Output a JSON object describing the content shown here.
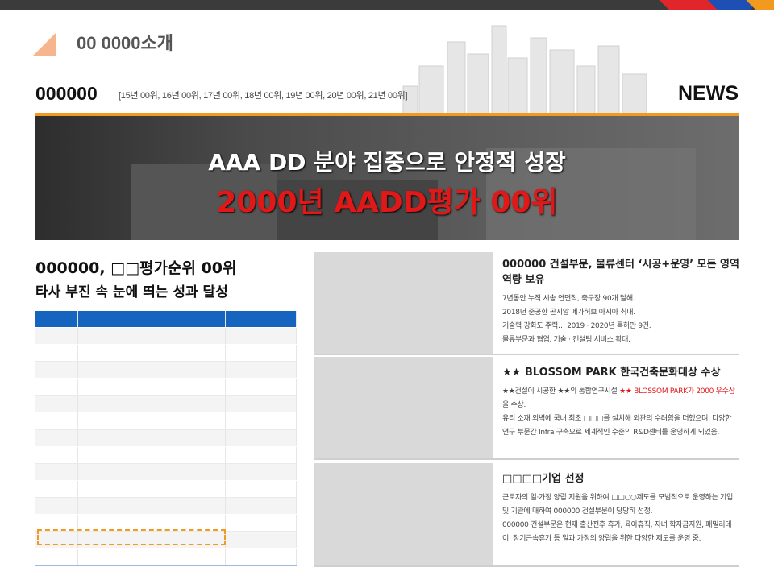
{
  "header": {
    "page_title": "00 0000소개",
    "company": "000000",
    "years": "[15년 00위, 16년 00위, 17년 00위, 18년 00위, 19년 00위, 20년 00위, 21년 00위]",
    "news": "NEWS"
  },
  "banner": {
    "line1": "AAA DD 분야 집중으로 안정적 성장",
    "line2": "2000년 AADD평가 00위"
  },
  "left": {
    "title1": "000000, □□평가순위 00위",
    "title2": "타사 부진 속 눈에 띄는 성과 달성"
  },
  "cards": [
    {
      "title": "000000 건설부문, 물류센터 ‘시공+운영’ 모든 영역 역량 보유",
      "lines": [
        "7년동안 누적 시송 연면적, 축구장 90개 달해.",
        "2018년 준공한 곤지암 메가허브 아시아 최대.",
        "기술력 강화도 주력… 2019 · 2020년 특허만 9건.",
        "물류부문과 협업, 기술 · 컨설팅 서비스 확대."
      ]
    },
    {
      "title": "★★ BLOSSOM PARK 한국건축문화대상 수상",
      "line1_a": "★★건설이 시공한 ★★의 통합연구시설 ",
      "line1_red": "★★ BLOSSOM PARK가 2000 우수상",
      "line1_b": "을 수상.",
      "line2": "유리 소재 외벽에 국내 최초 □□□를 설치해 외관의 수려함을 더했으며, 다양한 연구 부문간 Infra 구축으로 세계적인 수준의 R&D센터를 운영하게 되었음."
    },
    {
      "title": "□□□□기업  선정",
      "line1": "근로자의 일·가정 양립 지원을 위하여 □□○○제도를 모범적으로 운영하는 기업 및 기관에 대하여 000000 건설부문이 당당히 선정.",
      "line2": "000000 건설부문은 현재 출산전후 휴가, 육아휴직, 자녀 학자금지원, 패밀리데이, 장기근속휴가 등 일과 가정의 양립을 위한 다양한 제도를 운영 중."
    }
  ]
}
